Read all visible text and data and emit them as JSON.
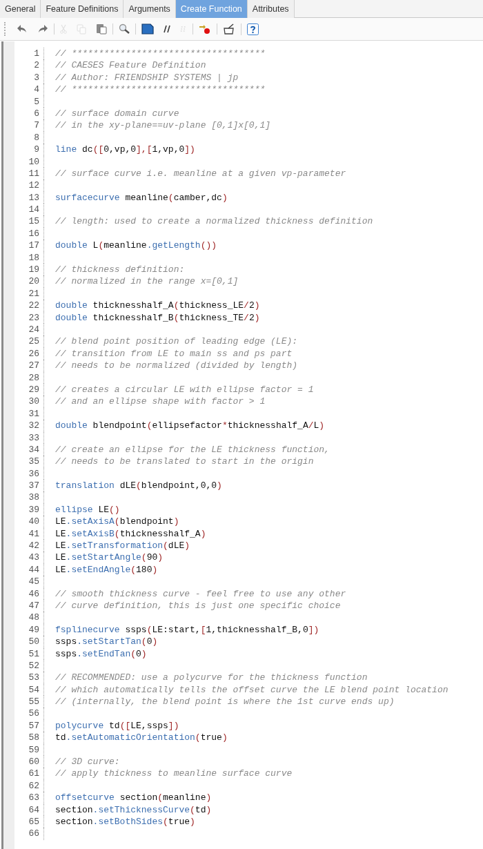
{
  "tabs": [
    {
      "label": "General",
      "selected": false
    },
    {
      "label": "Feature Definitions",
      "selected": false
    },
    {
      "label": "Arguments",
      "selected": false
    },
    {
      "label": "Create Function",
      "selected": true
    },
    {
      "label": "Attributes",
      "selected": false
    }
  ],
  "toolbar": [
    [
      {
        "kind": "undo",
        "disabled": false
      },
      {
        "kind": "redo",
        "disabled": false
      }
    ],
    [
      {
        "kind": "cut",
        "disabled": true
      },
      {
        "kind": "copy",
        "disabled": true
      },
      {
        "kind": "paste",
        "disabled": false
      }
    ],
    [
      {
        "kind": "find",
        "disabled": false
      }
    ],
    [
      {
        "kind": "shape",
        "disabled": false
      },
      {
        "kind": "comment",
        "disabled": false
      },
      {
        "kind": "uncomment",
        "disabled": true
      }
    ],
    [
      {
        "kind": "insert",
        "disabled": false
      }
    ],
    [
      {
        "kind": "clear",
        "disabled": false
      }
    ],
    [
      {
        "kind": "help",
        "disabled": false
      }
    ]
  ],
  "editor": {
    "lines": [
      {
        "number": "1",
        "tokens": [
          {
            "kind": "comment",
            "text": "// ************************************"
          }
        ]
      },
      {
        "number": "2",
        "tokens": [
          {
            "kind": "comment",
            "text": "// CAESES Feature Definition"
          }
        ]
      },
      {
        "number": "3",
        "tokens": [
          {
            "kind": "comment",
            "text": "// Author: FRIENDSHIP SYSTEMS | jp"
          }
        ]
      },
      {
        "number": "4",
        "tokens": [
          {
            "kind": "comment",
            "text": "// ************************************"
          }
        ]
      },
      {
        "number": "5"
      },
      {
        "number": "6",
        "tokens": [
          {
            "kind": "comment",
            "text": "// surface domain curve"
          }
        ]
      },
      {
        "number": "7",
        "tokens": [
          {
            "kind": "comment",
            "text": "// in the xy-plane==uv-plane [0,1]x[0,1]"
          }
        ]
      },
      {
        "number": "8"
      },
      {
        "number": "9",
        "tokens": [
          {
            "kind": "keyword",
            "text": "line"
          },
          {
            "kind": "ident",
            "text": " dc"
          },
          {
            "kind": "punct",
            "text": "(["
          },
          {
            "kind": "ident",
            "text": "0,vp,0"
          },
          {
            "kind": "punct",
            "text": "],["
          },
          {
            "kind": "ident",
            "text": "1,vp,0"
          },
          {
            "kind": "punct",
            "text": "])"
          }
        ]
      },
      {
        "number": "10"
      },
      {
        "number": "11",
        "tokens": [
          {
            "kind": "comment",
            "text": "// surface curve i.e. meanline at a given vp-parameter"
          }
        ]
      },
      {
        "number": "12"
      },
      {
        "number": "13",
        "tokens": [
          {
            "kind": "keyword",
            "text": "surfacecurve"
          },
          {
            "kind": "ident",
            "text": " meanline"
          },
          {
            "kind": "punct",
            "text": "("
          },
          {
            "kind": "ident",
            "text": "camber,dc"
          },
          {
            "kind": "punct",
            "text": ")"
          }
        ]
      },
      {
        "number": "14"
      },
      {
        "number": "15",
        "tokens": [
          {
            "kind": "comment",
            "text": "// length: used to create a normalized thickness definition"
          }
        ]
      },
      {
        "number": "16"
      },
      {
        "number": "17",
        "tokens": [
          {
            "kind": "keyword",
            "text": "double"
          },
          {
            "kind": "ident",
            "text": " L"
          },
          {
            "kind": "punct",
            "text": "("
          },
          {
            "kind": "ident",
            "text": "meanline"
          },
          {
            "kind": "method",
            "text": ".getLength"
          },
          {
            "kind": "punct",
            "text": "())"
          }
        ]
      },
      {
        "number": "18"
      },
      {
        "number": "19",
        "tokens": [
          {
            "kind": "comment",
            "text": "// thickness definition:"
          }
        ]
      },
      {
        "number": "20",
        "tokens": [
          {
            "kind": "comment",
            "text": "// normalized in the range x=[0,1]"
          }
        ]
      },
      {
        "number": "21"
      },
      {
        "number": "22",
        "tokens": [
          {
            "kind": "keyword",
            "text": "double"
          },
          {
            "kind": "ident",
            "text": " thicknesshalf_A"
          },
          {
            "kind": "punct",
            "text": "("
          },
          {
            "kind": "ident",
            "text": "thickness_LE"
          },
          {
            "kind": "punct",
            "text": "/"
          },
          {
            "kind": "ident",
            "text": "2"
          },
          {
            "kind": "punct",
            "text": ")"
          }
        ]
      },
      {
        "number": "23",
        "tokens": [
          {
            "kind": "keyword",
            "text": "double"
          },
          {
            "kind": "ident",
            "text": " thicknesshalf_B"
          },
          {
            "kind": "punct",
            "text": "("
          },
          {
            "kind": "ident",
            "text": "thickness_TE"
          },
          {
            "kind": "punct",
            "text": "/"
          },
          {
            "kind": "ident",
            "text": "2"
          },
          {
            "kind": "punct",
            "text": ")"
          }
        ]
      },
      {
        "number": "24"
      },
      {
        "number": "25",
        "tokens": [
          {
            "kind": "comment",
            "text": "// blend point position of leading edge (LE):"
          }
        ]
      },
      {
        "number": "26",
        "tokens": [
          {
            "kind": "comment",
            "text": "// transition from LE to main ss and ps part"
          }
        ]
      },
      {
        "number": "27",
        "tokens": [
          {
            "kind": "comment",
            "text": "// needs to be normalized (divided by length)"
          }
        ]
      },
      {
        "number": "28"
      },
      {
        "number": "29",
        "tokens": [
          {
            "kind": "comment",
            "text": "// creates a circular LE with ellipse factor = 1"
          }
        ]
      },
      {
        "number": "30",
        "tokens": [
          {
            "kind": "comment",
            "text": "// and an ellipse shape with factor > 1"
          }
        ]
      },
      {
        "number": "31"
      },
      {
        "number": "32",
        "tokens": [
          {
            "kind": "keyword",
            "text": "double"
          },
          {
            "kind": "ident",
            "text": " blendpoint"
          },
          {
            "kind": "punct",
            "text": "("
          },
          {
            "kind": "ident",
            "text": "ellipsefactor"
          },
          {
            "kind": "punct",
            "text": "*"
          },
          {
            "kind": "ident",
            "text": "thicknesshalf_A"
          },
          {
            "kind": "punct",
            "text": "/"
          },
          {
            "kind": "ident",
            "text": "L"
          },
          {
            "kind": "punct",
            "text": ")"
          }
        ]
      },
      {
        "number": "33"
      },
      {
        "number": "34",
        "tokens": [
          {
            "kind": "comment",
            "text": "// create an ellipse for the LE thickness function,"
          }
        ]
      },
      {
        "number": "35",
        "tokens": [
          {
            "kind": "comment",
            "text": "// needs to be translated to start in the origin"
          }
        ]
      },
      {
        "number": "36"
      },
      {
        "number": "37",
        "tokens": [
          {
            "kind": "keyword",
            "text": "translation"
          },
          {
            "kind": "ident",
            "text": " dLE"
          },
          {
            "kind": "punct",
            "text": "("
          },
          {
            "kind": "ident",
            "text": "blendpoint,0,0"
          },
          {
            "kind": "punct",
            "text": ")"
          }
        ]
      },
      {
        "number": "38"
      },
      {
        "number": "39",
        "tokens": [
          {
            "kind": "keyword",
            "text": "ellipse"
          },
          {
            "kind": "ident",
            "text": " LE"
          },
          {
            "kind": "punct",
            "text": "()"
          }
        ]
      },
      {
        "number": "40",
        "tokens": [
          {
            "kind": "ident",
            "text": "LE"
          },
          {
            "kind": "method",
            "text": ".setAxisA"
          },
          {
            "kind": "punct",
            "text": "("
          },
          {
            "kind": "ident",
            "text": "blendpoint"
          },
          {
            "kind": "punct",
            "text": ")"
          }
        ]
      },
      {
        "number": "41",
        "tokens": [
          {
            "kind": "ident",
            "text": "LE"
          },
          {
            "kind": "method",
            "text": ".setAxisB"
          },
          {
            "kind": "punct",
            "text": "("
          },
          {
            "kind": "ident",
            "text": "thicknesshalf_A"
          },
          {
            "kind": "punct",
            "text": ")"
          }
        ]
      },
      {
        "number": "42",
        "tokens": [
          {
            "kind": "ident",
            "text": "LE"
          },
          {
            "kind": "method",
            "text": ".setTransformation"
          },
          {
            "kind": "punct",
            "text": "("
          },
          {
            "kind": "ident",
            "text": "dLE"
          },
          {
            "kind": "punct",
            "text": ")"
          }
        ]
      },
      {
        "number": "43",
        "tokens": [
          {
            "kind": "ident",
            "text": "LE"
          },
          {
            "kind": "method",
            "text": ".setStartAngle"
          },
          {
            "kind": "punct",
            "text": "("
          },
          {
            "kind": "ident",
            "text": "90"
          },
          {
            "kind": "punct",
            "text": ")"
          }
        ]
      },
      {
        "number": "44",
        "tokens": [
          {
            "kind": "ident",
            "text": "LE"
          },
          {
            "kind": "method",
            "text": ".setEndAngle"
          },
          {
            "kind": "punct",
            "text": "("
          },
          {
            "kind": "ident",
            "text": "180"
          },
          {
            "kind": "punct",
            "text": ")"
          }
        ]
      },
      {
        "number": "45"
      },
      {
        "number": "46",
        "tokens": [
          {
            "kind": "comment",
            "text": "// smooth thickness curve - feel free to use any other"
          }
        ]
      },
      {
        "number": "47",
        "tokens": [
          {
            "kind": "comment",
            "text": "// curve definition, this is just one specific choice"
          }
        ]
      },
      {
        "number": "48"
      },
      {
        "number": "49",
        "tokens": [
          {
            "kind": "keyword",
            "text": "fsplinecurve"
          },
          {
            "kind": "ident",
            "text": " ssps"
          },
          {
            "kind": "punct",
            "text": "("
          },
          {
            "kind": "ident",
            "text": "LE:start,"
          },
          {
            "kind": "punct",
            "text": "["
          },
          {
            "kind": "ident",
            "text": "1,thicknesshalf_B,0"
          },
          {
            "kind": "punct",
            "text": "])"
          }
        ]
      },
      {
        "number": "50",
        "tokens": [
          {
            "kind": "ident",
            "text": "ssps"
          },
          {
            "kind": "method",
            "text": ".setStartTan"
          },
          {
            "kind": "punct",
            "text": "("
          },
          {
            "kind": "ident",
            "text": "0"
          },
          {
            "kind": "punct",
            "text": ")"
          }
        ]
      },
      {
        "number": "51",
        "tokens": [
          {
            "kind": "ident",
            "text": "ssps"
          },
          {
            "kind": "method",
            "text": ".setEndTan"
          },
          {
            "kind": "punct",
            "text": "("
          },
          {
            "kind": "ident",
            "text": "0"
          },
          {
            "kind": "punct",
            "text": ")"
          }
        ]
      },
      {
        "number": "52"
      },
      {
        "number": "53",
        "tokens": [
          {
            "kind": "comment",
            "text": "// RECOMMENDED: use a polycurve for the thickness function"
          }
        ]
      },
      {
        "number": "54",
        "tokens": [
          {
            "kind": "comment",
            "text": "// which automatically tells the offset curve the LE blend point location"
          }
        ]
      },
      {
        "number": "55",
        "tokens": [
          {
            "kind": "comment",
            "text": "// (internally, the blend point is where the 1st curve ends up)"
          }
        ]
      },
      {
        "number": "56"
      },
      {
        "number": "57",
        "tokens": [
          {
            "kind": "keyword",
            "text": "polycurve"
          },
          {
            "kind": "ident",
            "text": " td"
          },
          {
            "kind": "punct",
            "text": "(["
          },
          {
            "kind": "ident",
            "text": "LE,ssps"
          },
          {
            "kind": "punct",
            "text": "])"
          }
        ]
      },
      {
        "number": "58",
        "tokens": [
          {
            "kind": "ident",
            "text": "td"
          },
          {
            "kind": "method",
            "text": ".setAutomaticOrientation"
          },
          {
            "kind": "punct",
            "text": "("
          },
          {
            "kind": "ident",
            "text": "true"
          },
          {
            "kind": "punct",
            "text": ")"
          }
        ]
      },
      {
        "number": "59"
      },
      {
        "number": "60",
        "tokens": [
          {
            "kind": "comment",
            "text": "// 3D curve:"
          }
        ]
      },
      {
        "number": "61",
        "tokens": [
          {
            "kind": "comment",
            "text": "// apply thickness to meanline surface curve"
          }
        ]
      },
      {
        "number": "62"
      },
      {
        "number": "63",
        "tokens": [
          {
            "kind": "keyword",
            "text": "offsetcurve"
          },
          {
            "kind": "ident",
            "text": " section"
          },
          {
            "kind": "punct",
            "text": "("
          },
          {
            "kind": "ident",
            "text": "meanline"
          },
          {
            "kind": "punct",
            "text": ")"
          }
        ]
      },
      {
        "number": "64",
        "tokens": [
          {
            "kind": "ident",
            "text": "section"
          },
          {
            "kind": "method",
            "text": ".setThicknessCurve"
          },
          {
            "kind": "punct",
            "text": "("
          },
          {
            "kind": "ident",
            "text": "td"
          },
          {
            "kind": "punct",
            "text": ")"
          }
        ]
      },
      {
        "number": "65",
        "tokens": [
          {
            "kind": "ident",
            "text": "section"
          },
          {
            "kind": "method",
            "text": ".setBothSides"
          },
          {
            "kind": "punct",
            "text": "("
          },
          {
            "kind": "ident",
            "text": "true"
          },
          {
            "kind": "punct",
            "text": ")"
          }
        ]
      },
      {
        "number": "66"
      }
    ]
  }
}
